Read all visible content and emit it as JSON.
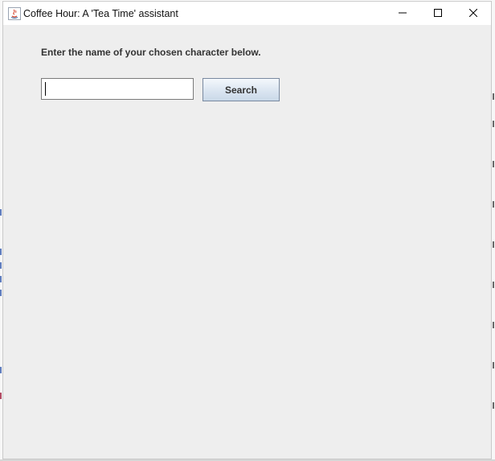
{
  "window": {
    "title": "Coffee Hour: A 'Tea Time' assistant",
    "controls": {
      "minimize_icon": "minimize-icon",
      "maximize_icon": "maximize-icon",
      "close_icon": "close-icon"
    }
  },
  "form": {
    "prompt": "Enter the name of your chosen character below.",
    "input_value": "",
    "search_label": "Search"
  },
  "colors": {
    "window_bg": "#eeeeee",
    "titlebar_bg": "#ffffff",
    "button_gradient_top": "#f4f8fc",
    "button_gradient_bottom": "#c9d8e8",
    "text": "#333333"
  }
}
